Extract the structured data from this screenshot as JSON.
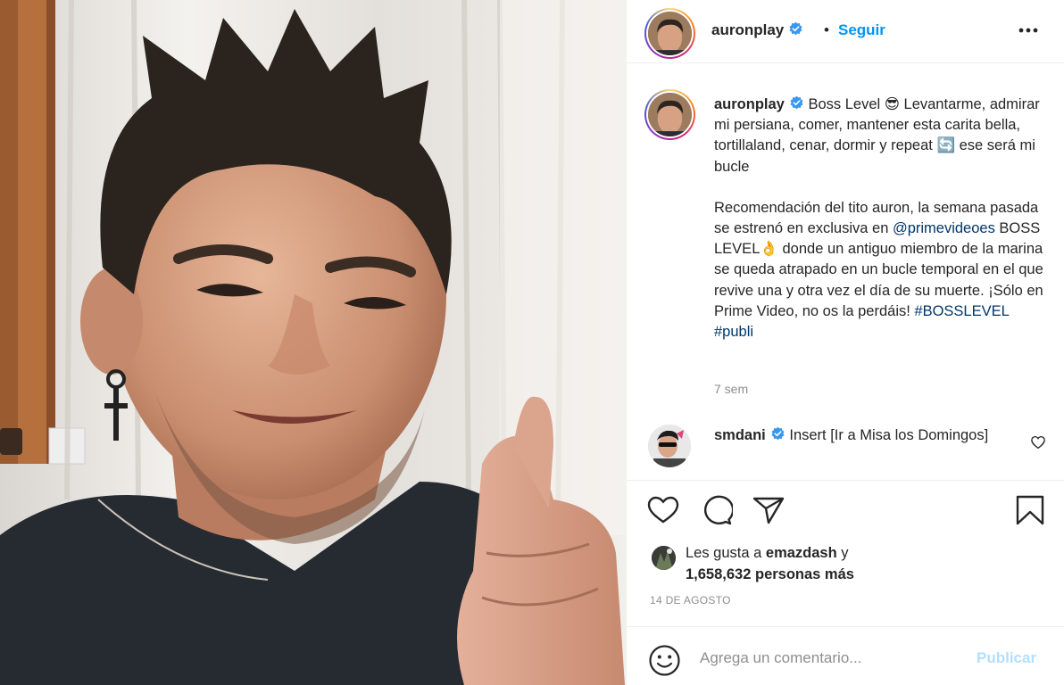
{
  "post": {
    "author": "auronplay",
    "follow_separator": "•",
    "follow_label": "Seguir",
    "more_icon": "more-horizontal-icon",
    "verified_icon": "verified-badge-icon"
  },
  "caption": {
    "username": "auronplay",
    "line1": " Boss Level 😎 Levantarme, admirar mi persiana, comer, mantener esta carita bella, tortillaland, cenar, dormir y repeat ",
    "repeat_emoji": "🔄",
    "line1_end": " ese será mi bucle",
    "para2_start": "Recomendación del tito auron, la semana pasada se estrenó en exclusiva en ",
    "mention": "@primevideoes",
    "para2_mid": " BOSS LEVEL",
    "hand_emoji": "👌",
    "para2_end": " donde un antiguo miembro de la marina se queda atrapado en un bucle temporal en el que revive una y otra vez el día de su muerte. ¡Sólo en Prime Video, no os la perdáis! ",
    "hashtag1": "#BOSSLEVEL",
    "hashtag_sep": " ",
    "hashtag2": "#publi",
    "time": "7 sem"
  },
  "comment": {
    "username": "smdani",
    "text": " Insert [Ir a Misa los Domingos]"
  },
  "actions": {
    "like_icon": "heart-icon",
    "comment_icon": "comment-bubble-icon",
    "share_icon": "paper-plane-icon",
    "save_icon": "bookmark-icon"
  },
  "likes": {
    "prefix": "Les gusta a ",
    "liker": "emazdash",
    "joiner": " y",
    "count": "1,658,632 personas más"
  },
  "date": "14 DE AGOSTO",
  "add_comment": {
    "placeholder": "Agrega un comentario...",
    "publish_label": "Publicar",
    "emoji_icon": "smiley-icon"
  },
  "colors": {
    "link": "#00376b",
    "follow": "#0095f6",
    "publish_disabled": "#b2dffc",
    "muted": "#8e8e8e",
    "verified": "#3897f0"
  }
}
